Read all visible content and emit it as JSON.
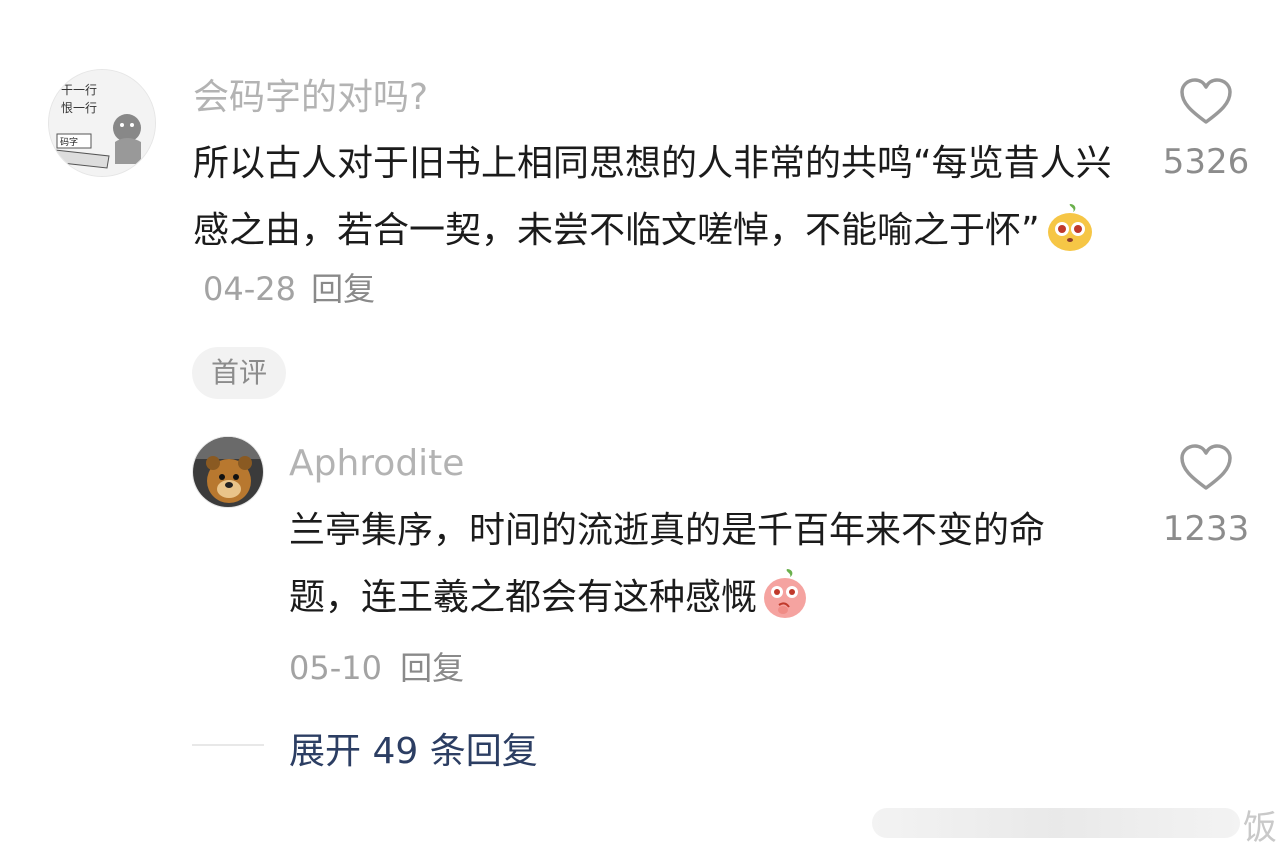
{
  "comments": [
    {
      "username": "会码字的对吗?",
      "avatar_lines": [
        "干一行",
        "恨一行"
      ],
      "avatar_sign": "码字",
      "text": "所以古人对于旧书上相同思想的人非常的共鸣“每览昔人兴感之由，若合一契，未尝不临文嗟悼，不能喻之于怀”",
      "emoji": "mango-face-emoji",
      "date": "04-28",
      "reply_label": "回复",
      "like_count": "5326",
      "badge": "首评"
    },
    {
      "username": "Aphrodite",
      "text": "兰亭集序，时间的流逝真的是千百年来不变的命题，连王羲之都会有这种感慨",
      "emoji": "peach-face-emoji",
      "date": "05-10",
      "reply_label": "回复",
      "like_count": "1233"
    }
  ],
  "expand": {
    "label": "展开 49 条回复"
  },
  "watermark": {
    "text": "饭"
  },
  "colors": {
    "username": "#b3b3b3",
    "link": "#2c3e63",
    "meta": "#a3a3a3"
  }
}
